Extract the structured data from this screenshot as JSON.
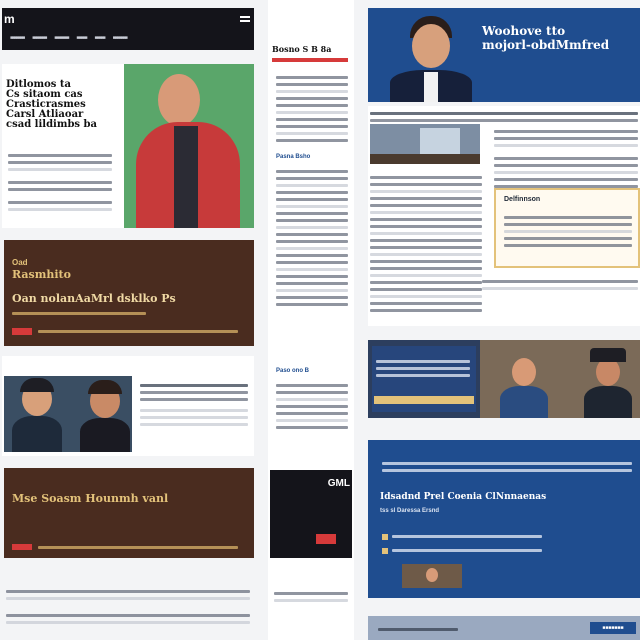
{
  "left": {
    "topbar": {
      "logo": "m",
      "nav": [
        "■■■■■■■",
        "■■■■■■■",
        "■■■■■■■",
        "■■■■■",
        "■■■■■",
        "■■■■■■■"
      ]
    },
    "hero": {
      "headline": "Ditlomos ta\nCs sitaom cas\nCrasticrasmes\nCarsl Atliaoar\ncsad lildimbs ba"
    },
    "promo1": {
      "kicker": "Oad",
      "title": "Rasmhito",
      "subtitle": "Oan nolanAaMrl dsklko Ps"
    },
    "promo2": {
      "title": "Mse Soasm Hounmh vanl"
    }
  },
  "middle": {
    "headline": "Bosno S B 8a",
    "sub1": "Pasna Bsho",
    "sub2": "Paso ono B",
    "banner": "GML"
  },
  "right": {
    "hero": {
      "title": "Woohove tto\nmojorl-obdMmfred"
    },
    "callout": {
      "title": "Delfinnson"
    },
    "blue_card": {
      "title": "Idsadnd Prel Coenia ClNnnaenas",
      "sub": "tss sl Daressa Ersnd"
    },
    "footer_button": "■■■■■■■"
  },
  "colors": {
    "dark_brown": "#4a2c1f",
    "navy": "#1f4d8f",
    "red": "#d63a3a",
    "green": "#5aa66a",
    "gold": "#e3c27a"
  }
}
